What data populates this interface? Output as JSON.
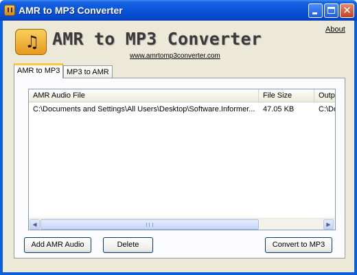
{
  "window": {
    "title": "AMR to MP3 Converter",
    "controls": {
      "close_glyph": "✕"
    }
  },
  "header": {
    "app_title": "AMR to MP3 Converter",
    "website": "www.amrtomp3converter.com",
    "about_label": "About",
    "logo_icon": "music-note-icon",
    "logo_glyph": "♫"
  },
  "tabs": [
    {
      "label": "AMR to MP3",
      "active": true
    },
    {
      "label": "MP3 to AMR",
      "active": false
    }
  ],
  "file_list": {
    "columns": [
      "AMR Audio File",
      "File Size",
      "Outp"
    ],
    "rows": [
      {
        "file": "C:\\Documents and Settings\\All Users\\Desktop\\Software.Informer...",
        "size": "47.05 KB",
        "output": "C:\\Do"
      }
    ],
    "scroll": {
      "left_arrow": "◀",
      "right_arrow": "▶"
    }
  },
  "buttons": {
    "add": "Add AMR Audio",
    "delete": "Delete",
    "convert": "Convert to MP3"
  },
  "colors": {
    "titlebar": "#0a55d8",
    "client_bg": "#ece9d8",
    "active_tab_accent": "#ffc83c"
  }
}
